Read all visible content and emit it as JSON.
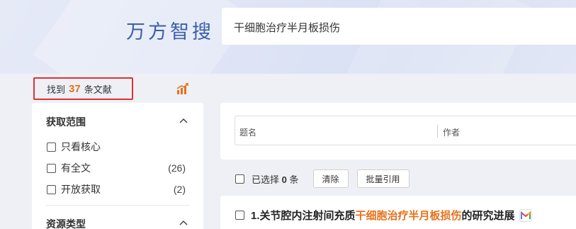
{
  "header": {
    "logo": "万方智搜",
    "search_query": "干细胞治疗半月板损伤"
  },
  "result_count": {
    "prefix": "找到",
    "count": "37",
    "suffix": "条文献"
  },
  "filters": {
    "access_range": {
      "title": "获取范围",
      "options": [
        {
          "label": "只看核心",
          "count": ""
        },
        {
          "label": "有全文",
          "count": "(26)"
        },
        {
          "label": "开放获取",
          "count": "(2)"
        }
      ]
    },
    "resource_type": {
      "title": "资源类型"
    }
  },
  "search_fields": {
    "title_label": "题名",
    "author_label": "作者"
  },
  "toolbar": {
    "selected_prefix": "已选择",
    "selected_count": "0",
    "selected_suffix": "条",
    "clear_label": "清除",
    "batch_cite_label": "批量引用"
  },
  "results": [
    {
      "title_prefix": "1.关节腔内注射间充质",
      "title_highlight": "干细胞治疗半月板损伤",
      "title_suffix": "的研究进展",
      "badge_icon": "gmail-m-icon"
    }
  ],
  "colors": {
    "accent_orange": "#e8701a",
    "highlight_red": "#e03131",
    "logo_blue": "#3a5fa8"
  }
}
